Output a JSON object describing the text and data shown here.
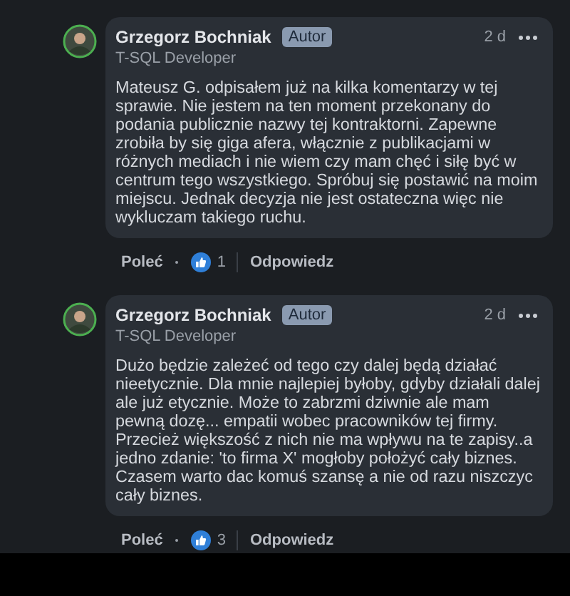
{
  "comments": [
    {
      "author": "Grzegorz Bochniak",
      "badge": "Autor",
      "subtitle": "T-SQL Developer",
      "time": "2 d",
      "body": "Mateusz G. odpisałem już na kilka komentarzy w tej sprawie. Nie jestem na ten moment przekonany do podania publicznie nazwy tej kontraktorni. Zapewne zrobiła by się giga afera, włącznie z publikacjami w różnych mediach i nie wiem czy mam chęć i siłę być w centrum tego wszystkiego. Spróbuj się postawić na moim miejscu. Jednak decyzja nie jest ostateczna więc nie wykluczam takiego ruchu.",
      "recommend": "Poleć",
      "likes": "1",
      "reply": "Odpowiedz"
    },
    {
      "author": "Grzegorz Bochniak",
      "badge": "Autor",
      "subtitle": "T-SQL Developer",
      "time": "2 d",
      "body": "Dużo będzie zależeć od tego czy dalej będą działać nieetycznie. Dla mnie najlepiej byłoby, gdyby działali dalej ale już etycznie. Może to zabrzmi dziwnie ale mam pewną dozę... empatii wobec pracowników tej firmy. Przecież większość z nich nie ma wpływu na te zapisy..a jedno zdanie: 'to firma X' mogłoby położyć cały biznes. Czasem warto dac komuś szansę a nie od razu niszczyc cały biznes.",
      "recommend": "Poleć",
      "likes": "3",
      "reply": "Odpowiedz"
    }
  ]
}
